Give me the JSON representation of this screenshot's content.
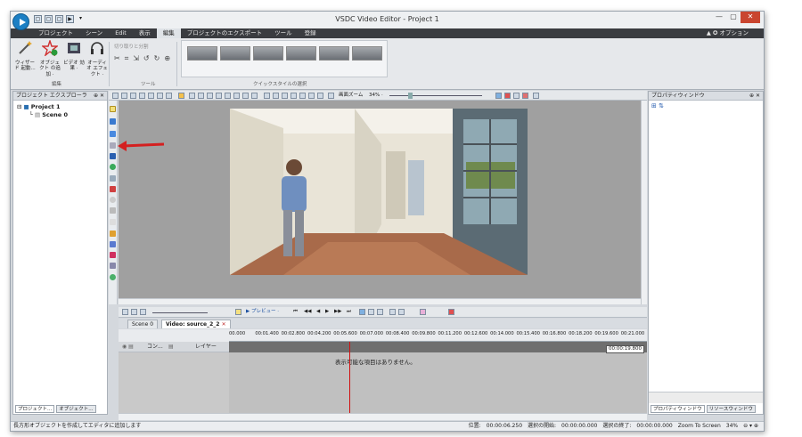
{
  "window": {
    "title": "VSDC Video Editor - Project 1",
    "qat": [
      "▢",
      "▢",
      "▢",
      "▶",
      "▾"
    ],
    "controls": {
      "minimize": "—",
      "maximize": "▢",
      "close": "✕"
    }
  },
  "menu": {
    "items": [
      "プロジェクト",
      "シーン",
      "Edit",
      "表示",
      "編集",
      "プロジェクトのエクスポート",
      "ツール",
      "登録"
    ],
    "active_index": 4,
    "options": "▲ ✪ オプション"
  },
  "ribbon": {
    "buttons": [
      {
        "label": "ウィザード 起動...",
        "icon": "wand-icon"
      },
      {
        "label": "オブジェクト の追加 ·",
        "icon": "star-add-icon"
      },
      {
        "label": "ビデオ 効果 ·",
        "icon": "film-icon"
      },
      {
        "label": "オーディオ エフェクト ·",
        "icon": "headphones-icon"
      }
    ],
    "group_edit": "編集",
    "cut_split": "切り取りと分割",
    "group_tools": "ツール",
    "group_quickstyle": "クイックスタイルの選択"
  },
  "left_panel": {
    "title": "プロジェクト エクスプローラ",
    "pin": "⊕ ✕",
    "tree": {
      "project": "Project 1",
      "scene": "Scene 0"
    },
    "tabs": [
      "プロジェクト...",
      "オブジェクト..."
    ]
  },
  "right_panel": {
    "title": "プロパティウィンドウ",
    "pin": "⊕ ✕",
    "tabs": [
      "プロパティウィンドウ",
      "リソースウィンドウ"
    ]
  },
  "toolstrip": {
    "zoom_label": "画面ズーム",
    "zoom_value": "34% ·"
  },
  "controls": {
    "preview": "▶ プレビュー ·",
    "transport": [
      "⏮",
      "◀◀",
      "◀",
      "▶",
      "▶▶",
      "⏭"
    ]
  },
  "timeline": {
    "tabs": [
      {
        "label": "Scene 0",
        "close": "✕"
      },
      {
        "label": "Video: source_2_2",
        "close": "✕"
      }
    ],
    "ruler_labels": [
      "00.000",
      "00:01.400",
      "00:02.800",
      "00:04.200",
      "00:05.600",
      "00:07.000",
      "00:08.400",
      "00:09.800",
      "00:11.200",
      "00:12.600",
      "00:14.000",
      "00:15.400",
      "00:16.800",
      "00:18.200",
      "00:19.600",
      "00:21.000"
    ],
    "cursor_time": "00:00:19.800",
    "col_com": "コン...",
    "col_layer": "レイヤー",
    "empty_message": "表示可能な項目はありません。"
  },
  "status": {
    "message": "長方形オブジェクトを作成してエディタに追加します",
    "position_label": "位置:",
    "position_value": "00:00:06.250",
    "sel_start_label": "選択の開始:",
    "sel_start_value": "00:00:00.000",
    "sel_end_label": "選択の終了:",
    "sel_end_value": "00:00:00.000",
    "zoom_label": "Zoom To Screen",
    "zoom_value": "34%"
  },
  "colors": {
    "menubar": "#3a3c40",
    "accent": "#1c7fc4",
    "playhead": "#d01010",
    "arrow": "#d42020"
  }
}
